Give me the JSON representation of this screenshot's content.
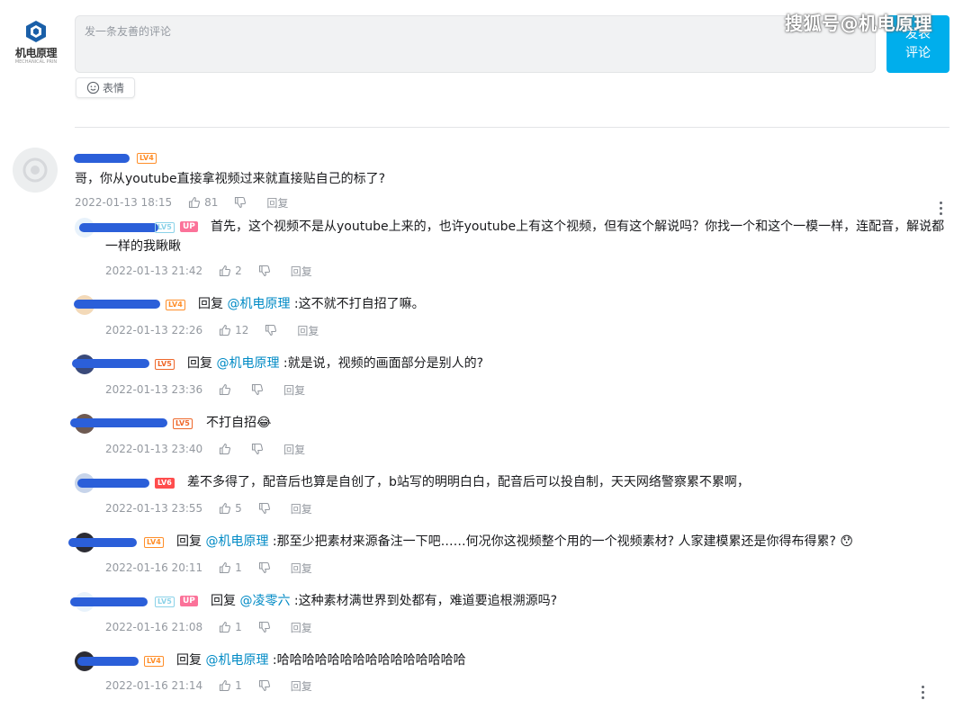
{
  "header": {
    "logo_name": "机电原理",
    "logo_sub": "MECHANICAL PRIN",
    "composer_placeholder": "发一条友善的评论",
    "submit_label": "发表\n评论",
    "emoji_label": "表情",
    "watermark": "搜狐号@机电原理"
  },
  "main_comment": {
    "level": "LV4",
    "content": "哥，你从youtube直接拿视频过来就直接贴自己的标了?",
    "time": "2022-01-13 18:15",
    "likes": "81",
    "reply_label": "回复"
  },
  "replies": [
    {
      "level": "LV5",
      "badge": "UP",
      "prefix": "",
      "mention": "",
      "text": "首先，这个视频不是从youtube上来的，也许youtube上有这个视频，但有这个解说吗？你找一个和这个一模一样，连配音，解说都",
      "text2": "一样的我瞅瞅",
      "time": "2022-01-13 21:42",
      "likes": "2",
      "reply_label": "回复"
    },
    {
      "level": "LV4",
      "prefix": "回复 ",
      "mention": "@机电原理",
      "text": " :这不就不打自招了嘛。",
      "time": "2022-01-13 22:26",
      "likes": "12",
      "reply_label": "回复"
    },
    {
      "level": "LV5",
      "prefix": "回复 ",
      "mention": "@机电原理",
      "text": " :就是说，视频的画面部分是别人的?",
      "time": "2022-01-13 23:36",
      "likes": "",
      "reply_label": "回复"
    },
    {
      "level": "LV5",
      "prefix": "",
      "mention": "",
      "text": "不打自招😂",
      "time": "2022-01-13 23:40",
      "likes": "",
      "reply_label": "回复"
    },
    {
      "level": "LV6",
      "prefix": "",
      "mention": "",
      "text": "差不多得了，配音后也算是自创了，b站写的明明白白，配音后可以投自制，天天网络警察累不累啊，",
      "time": "2022-01-13 23:55",
      "likes": "5",
      "reply_label": "回复"
    },
    {
      "level": "LV4",
      "prefix": "回复 ",
      "mention": "@机电原理",
      "text": " :那至少把素材来源备注一下吧……何况你这视频整个用的一个视频素材? 人家建模累还是你得布得累? 😯",
      "time": "2022-01-16 20:11",
      "likes": "1",
      "reply_label": "回复"
    },
    {
      "level": "LV5",
      "badge": "UP",
      "prefix": "回复 ",
      "mention": "@凌零六",
      "text": " :这种素材满世界到处都有，难道要追根溯源吗?",
      "time": "2022-01-16 21:08",
      "likes": "1",
      "reply_label": "回复"
    },
    {
      "level": "LV4",
      "prefix": "回复 ",
      "mention": "@机电原理",
      "text": " :哈哈哈哈哈哈哈哈哈哈哈哈哈哈哈",
      "time": "2022-01-16 21:14",
      "likes": "1",
      "reply_label": "回复"
    }
  ],
  "colors": {
    "accent": "#00aeec",
    "mention": "#008ac5",
    "up_badge": "#fb7299",
    "redaction": "#2b5fd9"
  }
}
